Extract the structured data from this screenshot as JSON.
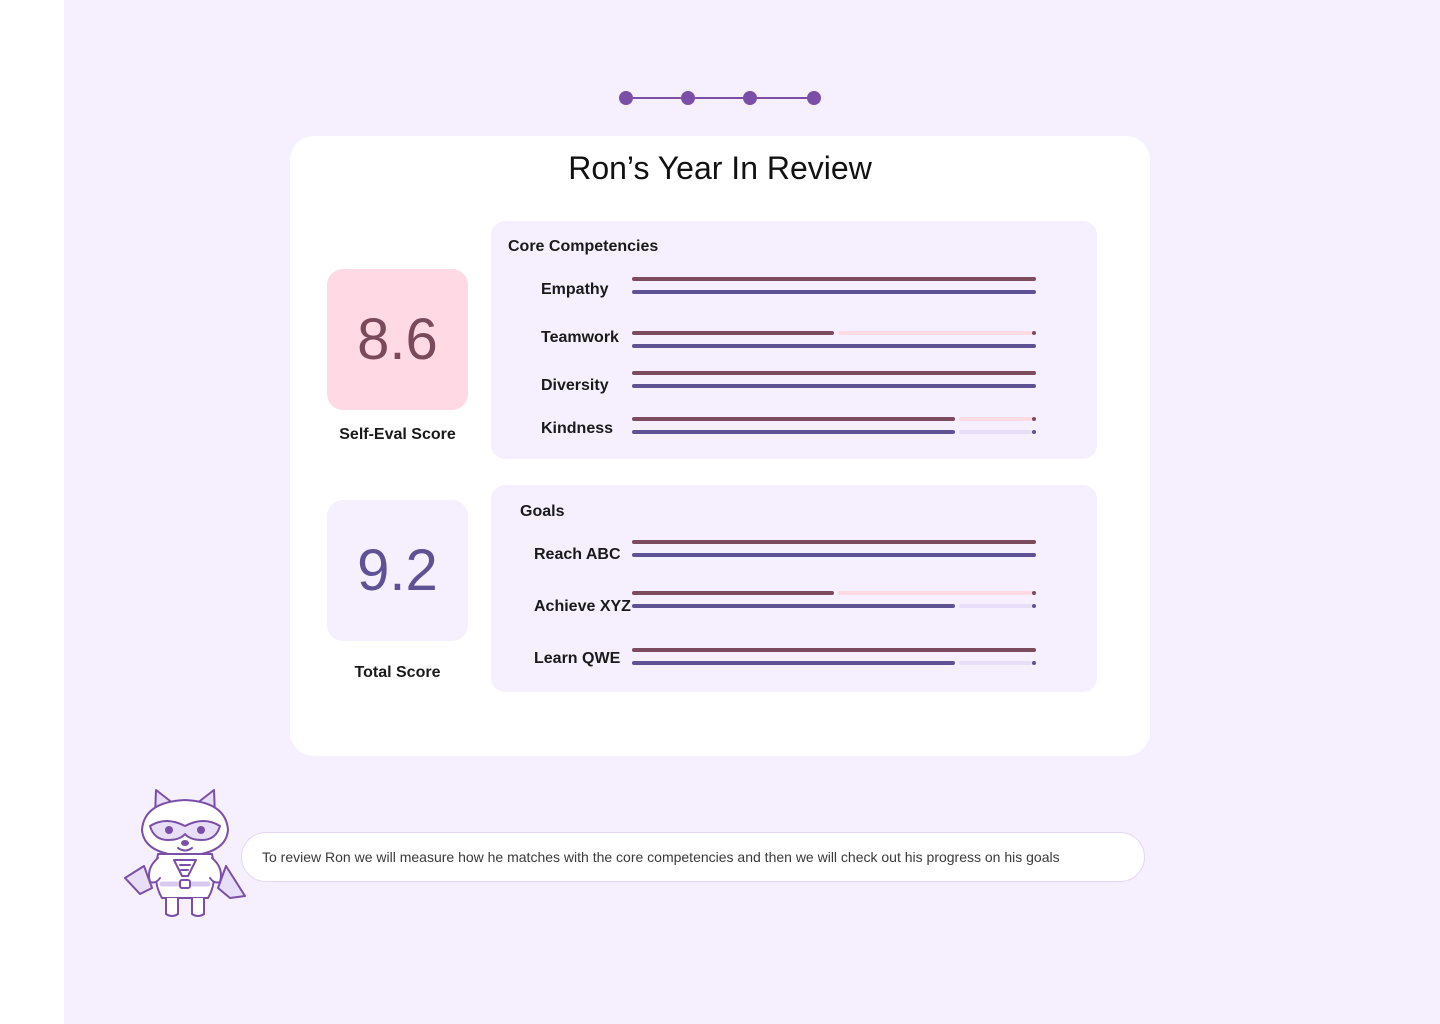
{
  "colors": {
    "page_background": "#f6effd",
    "accent": "#7b4fa8",
    "self_bar": "#7d4b5e",
    "self_bar_light": "#ffd9e3",
    "total_bar": "#5f5294",
    "total_bar_light": "#e8def8"
  },
  "stepper": {
    "steps": 4,
    "current": 4
  },
  "review": {
    "title": "Ron’s Year In Review",
    "self_eval": {
      "value": "8.6",
      "label": "Self-Eval Score"
    },
    "total": {
      "value": "9.2",
      "label": "Total Score"
    },
    "core": {
      "heading": "Core Competencies",
      "items": [
        {
          "label": "Empathy",
          "self": 1.0,
          "total": 1.0
        },
        {
          "label": "Teamwork",
          "self": 0.5,
          "total": 1.0
        },
        {
          "label": "Diversity",
          "self": 1.0,
          "total": 1.0
        },
        {
          "label": "Kindness",
          "self": 0.8,
          "total": 0.8
        }
      ]
    },
    "goals": {
      "heading": "Goals",
      "items": [
        {
          "label": "Reach ABC",
          "self": 1.0,
          "total": 1.0
        },
        {
          "label": "Achieve XYZ",
          "self": 0.5,
          "total": 0.8
        },
        {
          "label": "Learn QWE",
          "self": 1.0,
          "total": 0.8
        }
      ]
    }
  },
  "mascot": {
    "icon": "raccoon-superhero-mascot-icon"
  },
  "message": {
    "text": "To review Ron we will measure how he matches with the core competencies and then we will check out his progress on his goals"
  }
}
